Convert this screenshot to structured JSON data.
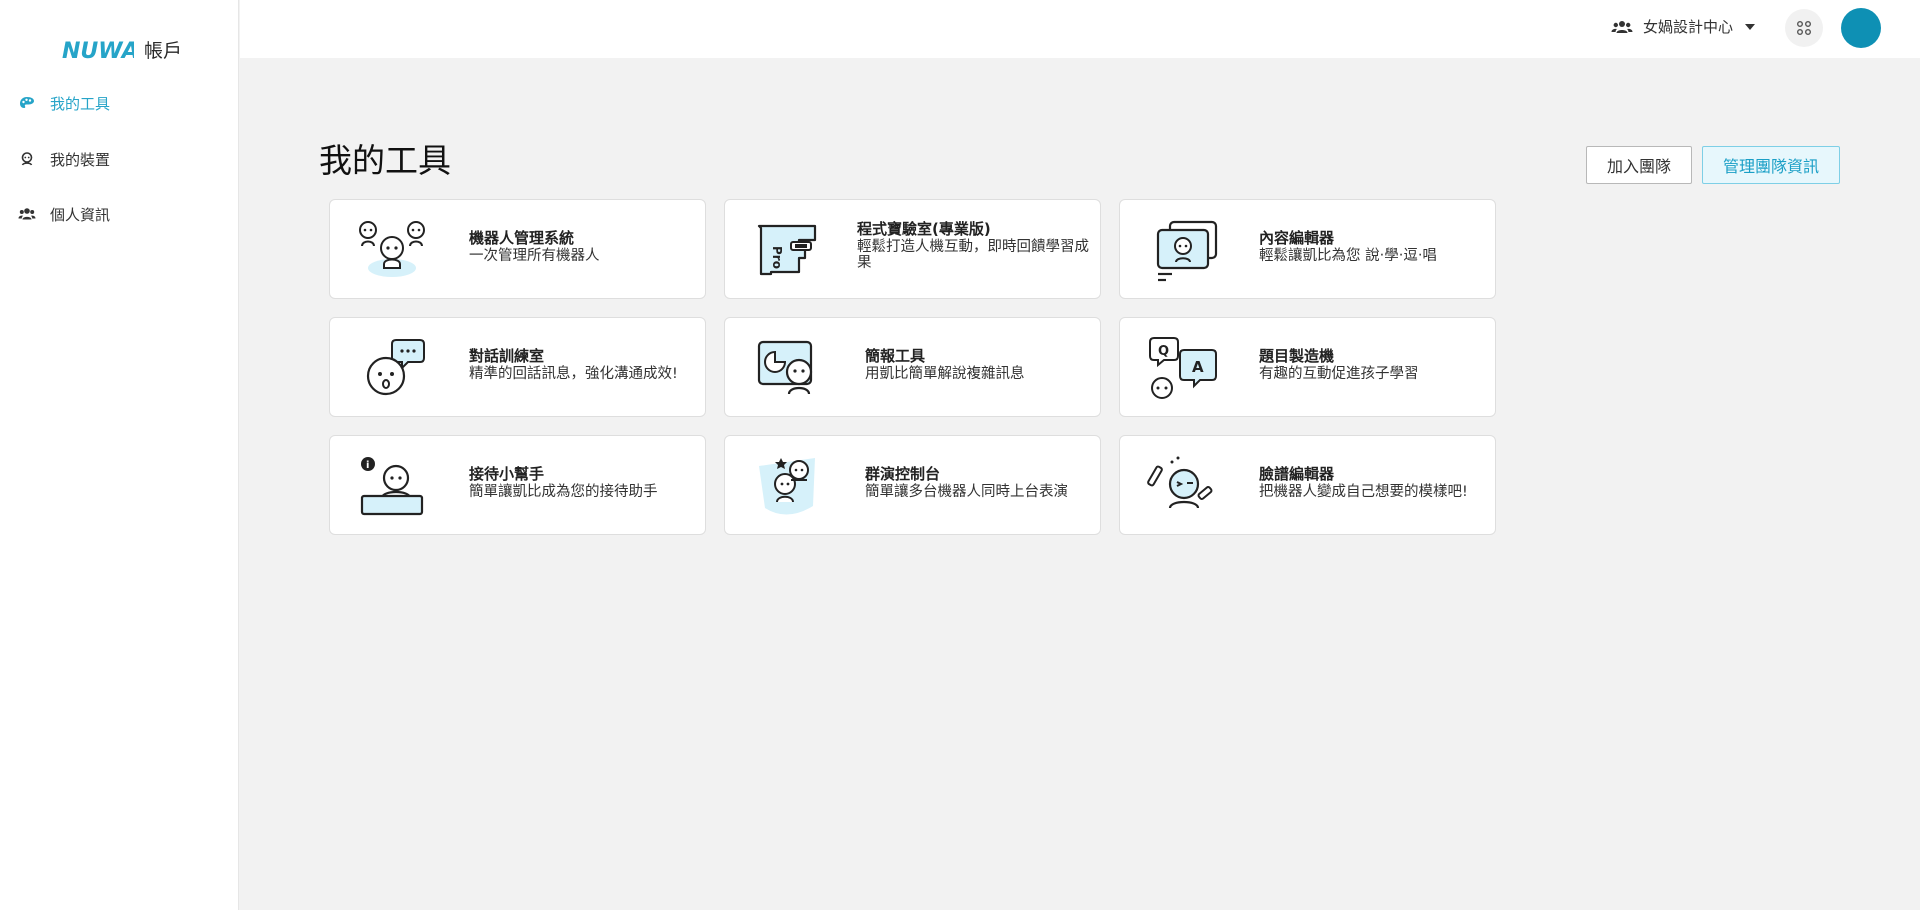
{
  "app": {
    "brand_logo_text": "NUWA",
    "brand_name": "帳戶",
    "accent_color": "#26a4c8"
  },
  "sidebar": {
    "items": [
      {
        "label": "我的工具",
        "icon": "palette-icon",
        "active": true
      },
      {
        "label": "我的裝置",
        "icon": "robot-icon",
        "active": false
      },
      {
        "label": "個人資訊",
        "icon": "users-icon",
        "active": false
      }
    ]
  },
  "topbar": {
    "team_name": "女媧設計中心",
    "team_icon": "users-icon",
    "apps_icon": "grid-icon",
    "avatar_color": "#0e90b4"
  },
  "main": {
    "title": "我的工具",
    "join_team_label": "加入團隊",
    "manage_team_label": "管理團隊資訊",
    "tools": [
      {
        "title": "機器人管理系統",
        "desc": "一次管理所有機器人"
      },
      {
        "title": "程式寶驗室(專業版)",
        "desc": "輕鬆打造人機互動，即時回饋學習成果"
      },
      {
        "title": "內容編輯器",
        "desc": "輕鬆讓凱比為您 說‧學‧逗‧唱"
      },
      {
        "title": "對話訓練室",
        "desc": "精準的回話訊息，強化溝通成效!"
      },
      {
        "title": "簡報工具",
        "desc": "用凱比簡單解說複雜訊息"
      },
      {
        "title": "題目製造機",
        "desc": "有趣的互動促進孩子學習"
      },
      {
        "title": "接待小幫手",
        "desc": "簡單讓凱比成為您的接待助手"
      },
      {
        "title": "群演控制台",
        "desc": "簡單讓多台機器人同時上台表演"
      },
      {
        "title": "臉譜編輯器",
        "desc": "把機器人變成自己想要的模樣吧!"
      }
    ],
    "tool_icon_text": {
      "pro": "Pro",
      "q": "Q",
      "a": "A",
      "info": "i"
    }
  }
}
